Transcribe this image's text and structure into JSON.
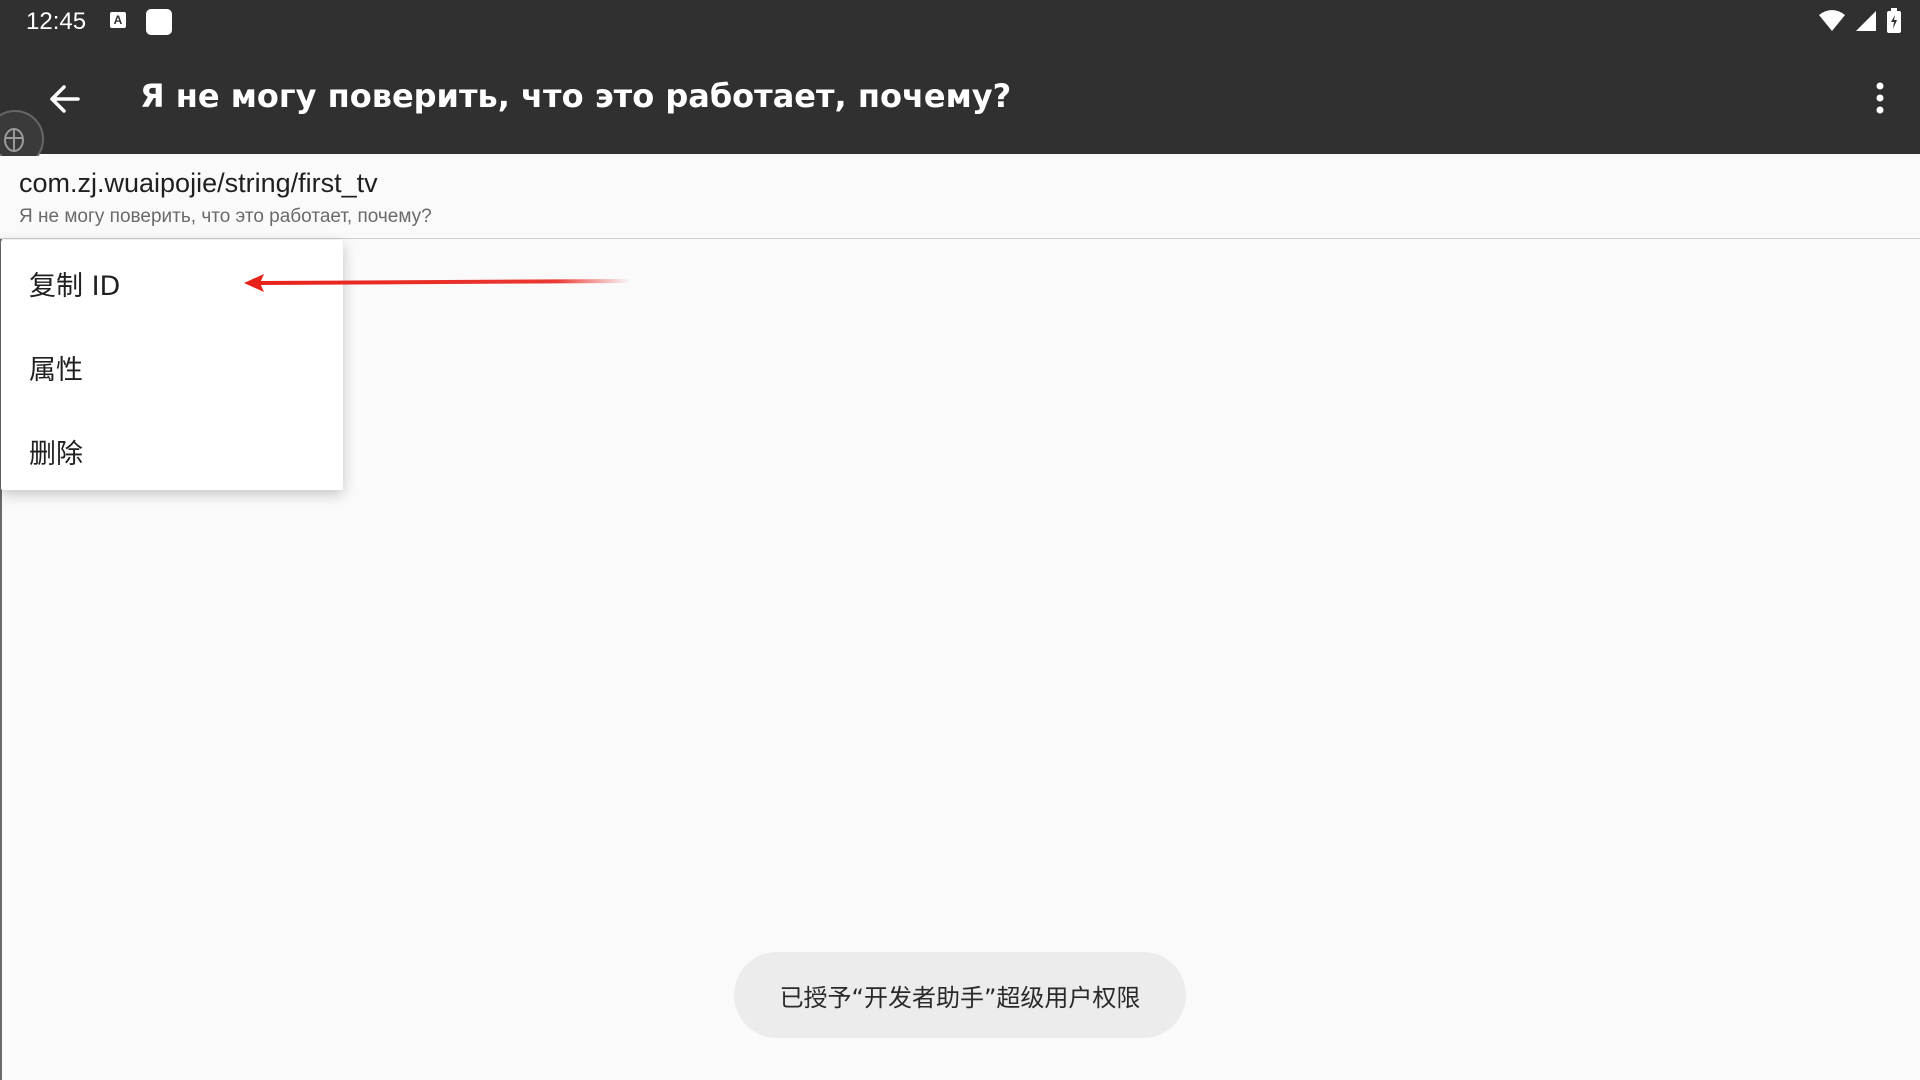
{
  "status_bar": {
    "time": "12:45",
    "icons": [
      "a-notification-icon",
      "white-square-notification-icon",
      "wifi-icon",
      "signal-icon",
      "battery-icon"
    ],
    "a_icon_letter": "A"
  },
  "toolbar": {
    "title": "Я не могу поверить, что это работает, почему?",
    "back_icon": "arrow-left-icon",
    "overflow_icon": "more-vert-icon"
  },
  "item": {
    "id": "com.zj.wuaipojie/string/first_tv",
    "value": "Я не могу поверить, что это работает, почему?"
  },
  "context_menu": {
    "items": [
      {
        "label": "复制 ID"
      },
      {
        "label": "属性"
      },
      {
        "label": "删除"
      }
    ]
  },
  "annotation": {
    "color": "#e8221b"
  },
  "toast": {
    "text": "已授予“开发者助手”超级用户权限"
  },
  "colors": {
    "appbar": "#303030",
    "background": "#fafafa"
  }
}
